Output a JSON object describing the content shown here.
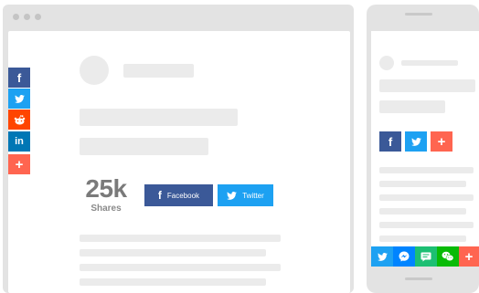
{
  "desktop": {
    "share_count": "25k",
    "share_count_label": "Shares",
    "facebook_button_label": "Facebook",
    "twitter_button_label": "Twitter",
    "floating_bar": [
      "facebook-icon",
      "twitter-icon",
      "reddit-icon",
      "linkedin-icon",
      "plus-icon"
    ]
  },
  "mobile": {
    "inline_buttons": [
      "facebook-icon",
      "twitter-icon",
      "plus-icon"
    ],
    "bottom_bar": [
      "twitter-icon",
      "messenger-icon",
      "sms-icon",
      "wechat-icon",
      "plus-icon"
    ]
  },
  "colors": {
    "facebook": "#3b5998",
    "twitter": "#1da1f2",
    "reddit": "#ff4500",
    "linkedin": "#0077b5",
    "more": "#ff6550",
    "messenger": "#0084ff",
    "sms": "#1dbf73",
    "wechat": "#09bb07"
  }
}
